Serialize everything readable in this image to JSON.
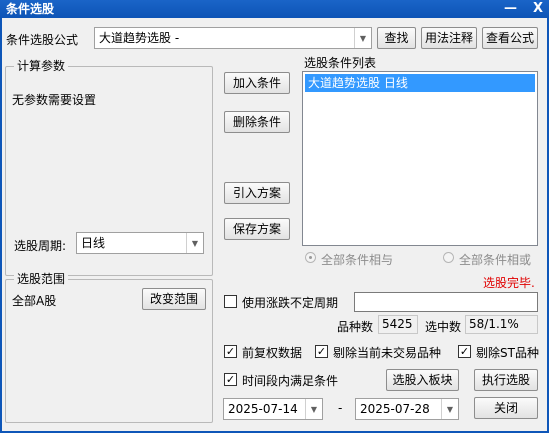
{
  "window": {
    "title": "条件选股",
    "minimize_glyph": "—",
    "close_glyph": "X"
  },
  "formula": {
    "label": "条件选股公式",
    "selected": "大道趋势选股  -",
    "find_button": "查找",
    "usage_button": "用法注释",
    "view_button": "查看公式"
  },
  "params": {
    "group_label": "计算参数",
    "text": "无参数需要设置",
    "period_label": "选股周期:",
    "period_value": "日线"
  },
  "conditions": {
    "add_button": "加入条件",
    "delete_button": "删除条件",
    "load_button": "引入方案",
    "save_button": "保存方案",
    "list_label": "选股条件列表",
    "items": [
      "大道趋势选股  日线"
    ],
    "radio_and": "全部条件相与",
    "radio_or": "全部条件相或",
    "status": "选股完毕."
  },
  "range": {
    "group_label": "选股范围",
    "value": "全部A股",
    "change_button": "改变范围"
  },
  "options": {
    "variable_period_label": "使用涨跌不定周期",
    "variable_period_checked": false,
    "variable_period_value": "",
    "stock_count_label": "品种数",
    "stock_count": "5425",
    "selected_label": "选中数",
    "selected_value": "58/1.1%",
    "forward_adjust_label": "前复权数据",
    "forward_adjust_checked": true,
    "exclude_untraded_label": "剔除当前未交易品种",
    "exclude_untraded_checked": true,
    "exclude_st_label": "剔除ST品种",
    "exclude_st_checked": true,
    "time_range_label": "时间段内满足条件",
    "time_range_checked": true,
    "date_from": "2025-07-14",
    "date_separator": "-",
    "date_to": "2025-07-28"
  },
  "actions": {
    "to_block_button": "选股入板块",
    "run_button": "执行选股",
    "close_button": "关闭"
  },
  "icons": {
    "dropdown": "chevron-down-icon",
    "check": "check-icon"
  }
}
